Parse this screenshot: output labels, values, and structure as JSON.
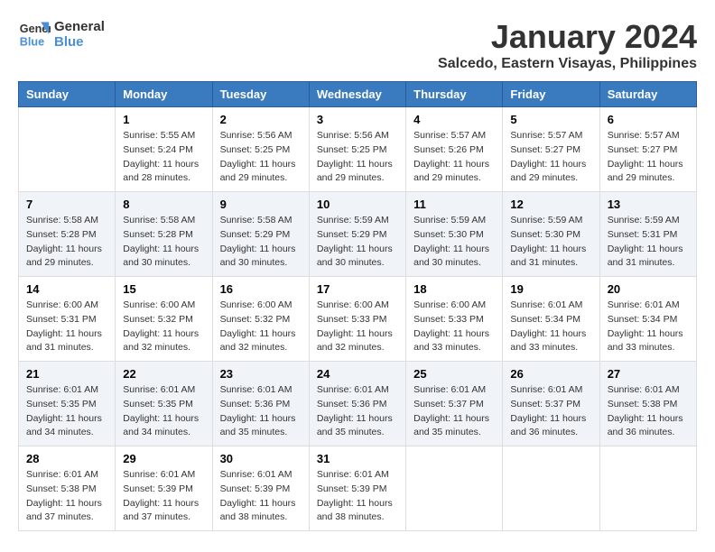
{
  "header": {
    "logo_line1": "General",
    "logo_line2": "Blue",
    "month": "January 2024",
    "location": "Salcedo, Eastern Visayas, Philippines"
  },
  "columns": [
    "Sunday",
    "Monday",
    "Tuesday",
    "Wednesday",
    "Thursday",
    "Friday",
    "Saturday"
  ],
  "weeks": [
    [
      {
        "day": "",
        "info": ""
      },
      {
        "day": "1",
        "info": "Sunrise: 5:55 AM\nSunset: 5:24 PM\nDaylight: 11 hours\nand 28 minutes."
      },
      {
        "day": "2",
        "info": "Sunrise: 5:56 AM\nSunset: 5:25 PM\nDaylight: 11 hours\nand 29 minutes."
      },
      {
        "day": "3",
        "info": "Sunrise: 5:56 AM\nSunset: 5:25 PM\nDaylight: 11 hours\nand 29 minutes."
      },
      {
        "day": "4",
        "info": "Sunrise: 5:57 AM\nSunset: 5:26 PM\nDaylight: 11 hours\nand 29 minutes."
      },
      {
        "day": "5",
        "info": "Sunrise: 5:57 AM\nSunset: 5:27 PM\nDaylight: 11 hours\nand 29 minutes."
      },
      {
        "day": "6",
        "info": "Sunrise: 5:57 AM\nSunset: 5:27 PM\nDaylight: 11 hours\nand 29 minutes."
      }
    ],
    [
      {
        "day": "7",
        "info": "Sunrise: 5:58 AM\nSunset: 5:28 PM\nDaylight: 11 hours\nand 29 minutes."
      },
      {
        "day": "8",
        "info": "Sunrise: 5:58 AM\nSunset: 5:28 PM\nDaylight: 11 hours\nand 30 minutes."
      },
      {
        "day": "9",
        "info": "Sunrise: 5:58 AM\nSunset: 5:29 PM\nDaylight: 11 hours\nand 30 minutes."
      },
      {
        "day": "10",
        "info": "Sunrise: 5:59 AM\nSunset: 5:29 PM\nDaylight: 11 hours\nand 30 minutes."
      },
      {
        "day": "11",
        "info": "Sunrise: 5:59 AM\nSunset: 5:30 PM\nDaylight: 11 hours\nand 30 minutes."
      },
      {
        "day": "12",
        "info": "Sunrise: 5:59 AM\nSunset: 5:30 PM\nDaylight: 11 hours\nand 31 minutes."
      },
      {
        "day": "13",
        "info": "Sunrise: 5:59 AM\nSunset: 5:31 PM\nDaylight: 11 hours\nand 31 minutes."
      }
    ],
    [
      {
        "day": "14",
        "info": "Sunrise: 6:00 AM\nSunset: 5:31 PM\nDaylight: 11 hours\nand 31 minutes."
      },
      {
        "day": "15",
        "info": "Sunrise: 6:00 AM\nSunset: 5:32 PM\nDaylight: 11 hours\nand 32 minutes."
      },
      {
        "day": "16",
        "info": "Sunrise: 6:00 AM\nSunset: 5:32 PM\nDaylight: 11 hours\nand 32 minutes."
      },
      {
        "day": "17",
        "info": "Sunrise: 6:00 AM\nSunset: 5:33 PM\nDaylight: 11 hours\nand 32 minutes."
      },
      {
        "day": "18",
        "info": "Sunrise: 6:00 AM\nSunset: 5:33 PM\nDaylight: 11 hours\nand 33 minutes."
      },
      {
        "day": "19",
        "info": "Sunrise: 6:01 AM\nSunset: 5:34 PM\nDaylight: 11 hours\nand 33 minutes."
      },
      {
        "day": "20",
        "info": "Sunrise: 6:01 AM\nSunset: 5:34 PM\nDaylight: 11 hours\nand 33 minutes."
      }
    ],
    [
      {
        "day": "21",
        "info": "Sunrise: 6:01 AM\nSunset: 5:35 PM\nDaylight: 11 hours\nand 34 minutes."
      },
      {
        "day": "22",
        "info": "Sunrise: 6:01 AM\nSunset: 5:35 PM\nDaylight: 11 hours\nand 34 minutes."
      },
      {
        "day": "23",
        "info": "Sunrise: 6:01 AM\nSunset: 5:36 PM\nDaylight: 11 hours\nand 35 minutes."
      },
      {
        "day": "24",
        "info": "Sunrise: 6:01 AM\nSunset: 5:36 PM\nDaylight: 11 hours\nand 35 minutes."
      },
      {
        "day": "25",
        "info": "Sunrise: 6:01 AM\nSunset: 5:37 PM\nDaylight: 11 hours\nand 35 minutes."
      },
      {
        "day": "26",
        "info": "Sunrise: 6:01 AM\nSunset: 5:37 PM\nDaylight: 11 hours\nand 36 minutes."
      },
      {
        "day": "27",
        "info": "Sunrise: 6:01 AM\nSunset: 5:38 PM\nDaylight: 11 hours\nand 36 minutes."
      }
    ],
    [
      {
        "day": "28",
        "info": "Sunrise: 6:01 AM\nSunset: 5:38 PM\nDaylight: 11 hours\nand 37 minutes."
      },
      {
        "day": "29",
        "info": "Sunrise: 6:01 AM\nSunset: 5:39 PM\nDaylight: 11 hours\nand 37 minutes."
      },
      {
        "day": "30",
        "info": "Sunrise: 6:01 AM\nSunset: 5:39 PM\nDaylight: 11 hours\nand 38 minutes."
      },
      {
        "day": "31",
        "info": "Sunrise: 6:01 AM\nSunset: 5:39 PM\nDaylight: 11 hours\nand 38 minutes."
      },
      {
        "day": "",
        "info": ""
      },
      {
        "day": "",
        "info": ""
      },
      {
        "day": "",
        "info": ""
      }
    ]
  ]
}
